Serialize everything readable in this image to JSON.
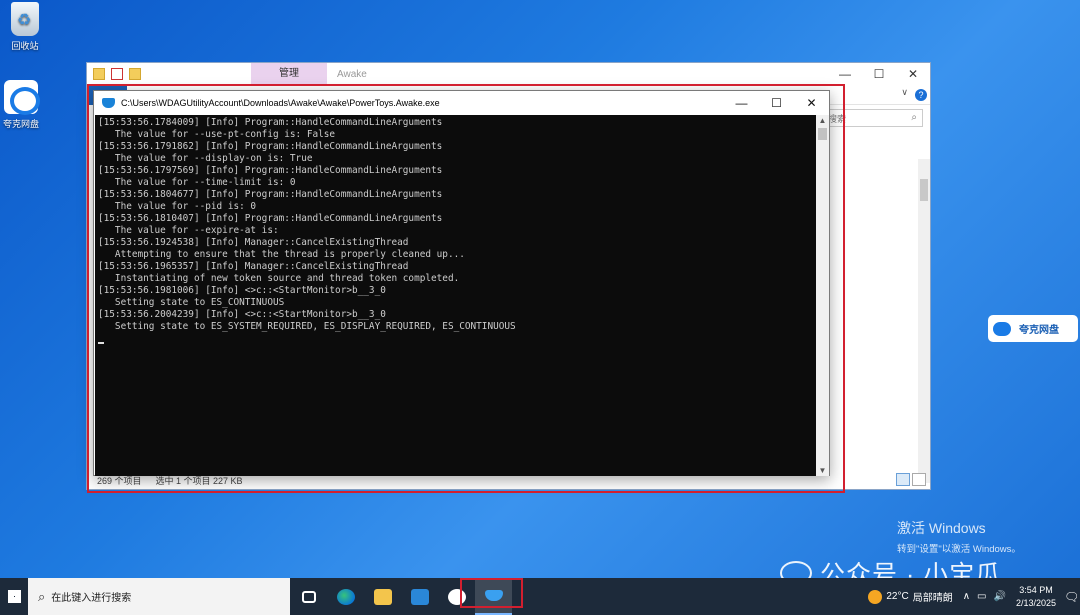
{
  "desktop": {
    "recycle_bin_label": "回收站",
    "quark_drive_label": "夸克网盘"
  },
  "explorer": {
    "manage_tab": "管理",
    "app_title": "Awake",
    "min_glyph": "—",
    "max_glyph": "☐",
    "close_glyph": "✕",
    "ribbon_chevron": "∨",
    "help_glyph": "?",
    "search_placeholder": "搜索",
    "search_glyph": "⌕",
    "status_items": "269 个项目",
    "status_selected": "选中 1 个项目  227 KB"
  },
  "console": {
    "title": "C:\\Users\\WDAGUtilityAccount\\Downloads\\Awake\\Awake\\PowerToys.Awake.exe",
    "min_glyph": "—",
    "max_glyph": "☐",
    "close_glyph": "✕",
    "scroll_up_glyph": "▲",
    "scroll_down_glyph": "▼",
    "lines": [
      "[15:53:56.1784009] [Info] Program::HandleCommandLineArguments",
      "   The value for --use-pt-config is: False",
      "[15:53:56.1791862] [Info] Program::HandleCommandLineArguments",
      "   The value for --display-on is: True",
      "[15:53:56.1797569] [Info] Program::HandleCommandLineArguments",
      "   The value for --time-limit is: 0",
      "[15:53:56.1804677] [Info] Program::HandleCommandLineArguments",
      "   The value for --pid is: 0",
      "[15:53:56.1810407] [Info] Program::HandleCommandLineArguments",
      "   The value for --expire-at is:",
      "[15:53:56.1924538] [Info] Manager::CancelExistingThread",
      "   Attempting to ensure that the thread is properly cleaned up...",
      "[15:53:56.1965357] [Info] Manager::CancelExistingThread",
      "   Instantiating of new token source and thread token completed.",
      "[15:53:56.1981006] [Info] <>c::<StartMonitor>b__3_0",
      "   Setting state to ES_CONTINUOUS",
      "[15:53:56.2004239] [Info] <>c::<StartMonitor>b__3_0",
      "   Setting state to ES_SYSTEM_REQUIRED, ES_DISPLAY_REQUIRED, ES_CONTINUOUS"
    ]
  },
  "side_pill": {
    "label": "夸克网盘"
  },
  "activation": {
    "title": "激活 Windows",
    "subtitle": "转到\"设置\"以激活 Windows。"
  },
  "watermark": {
    "text": "公众号 · 小宝瓜"
  },
  "taskbar": {
    "search_placeholder": "在此键入进行搜索",
    "search_glyph": "⌕",
    "temperature": "22°C",
    "weather": "局部晴朗",
    "tray_chevron": "∧",
    "volume_glyph": "🔊",
    "notification_glyph": "🗨",
    "time": "3:54 PM",
    "date": "2/13/2025"
  }
}
